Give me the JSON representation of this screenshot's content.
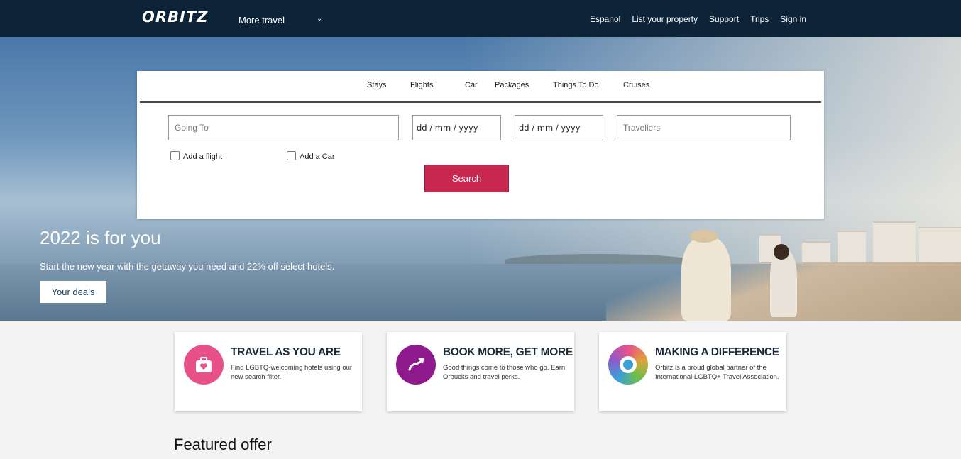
{
  "header": {
    "logo": "ORBITZ",
    "more_travel": "More travel",
    "nav": [
      "Espanol",
      "List your property",
      "Support",
      "Trips",
      "Sign in"
    ]
  },
  "search": {
    "tabs": [
      "Stays",
      "Flights",
      "Car",
      "Packages",
      "Things To Do",
      "Cruises"
    ],
    "going_to_placeholder": "Going To",
    "checkin_placeholder": "dd / mm / yyyy",
    "checkout_placeholder": "dd / mm / yyyy",
    "travellers_placeholder": "Travellers",
    "add_flight": "Add a flight",
    "add_car": "Add a Car",
    "search_button": "Search"
  },
  "hero": {
    "title": "2022 is for you",
    "subtitle": "Start the new year with the getaway you need and 22% off select hotels.",
    "button": "Your deals"
  },
  "cards": [
    {
      "title": "TRAVEL AS YOU ARE",
      "text": "Find LGBTQ-welcoming hotels using our new search filter.",
      "icon": "suitcase-heart-icon",
      "color": "#e8508a"
    },
    {
      "title": "BOOK MORE, GET MORE",
      "text": "Good things come to those who go. Earn Orbucks and travel perks.",
      "icon": "orbucks-icon",
      "color": "#8e1a8e"
    },
    {
      "title": "MAKING A DIFFERENCE",
      "text": "Orbitz is a proud global partner of the International LGBTQ+ Travel Association.",
      "icon": "iglta-globe-icon",
      "color": "#e0a23a"
    }
  ],
  "featured_title": "Featured offer"
}
